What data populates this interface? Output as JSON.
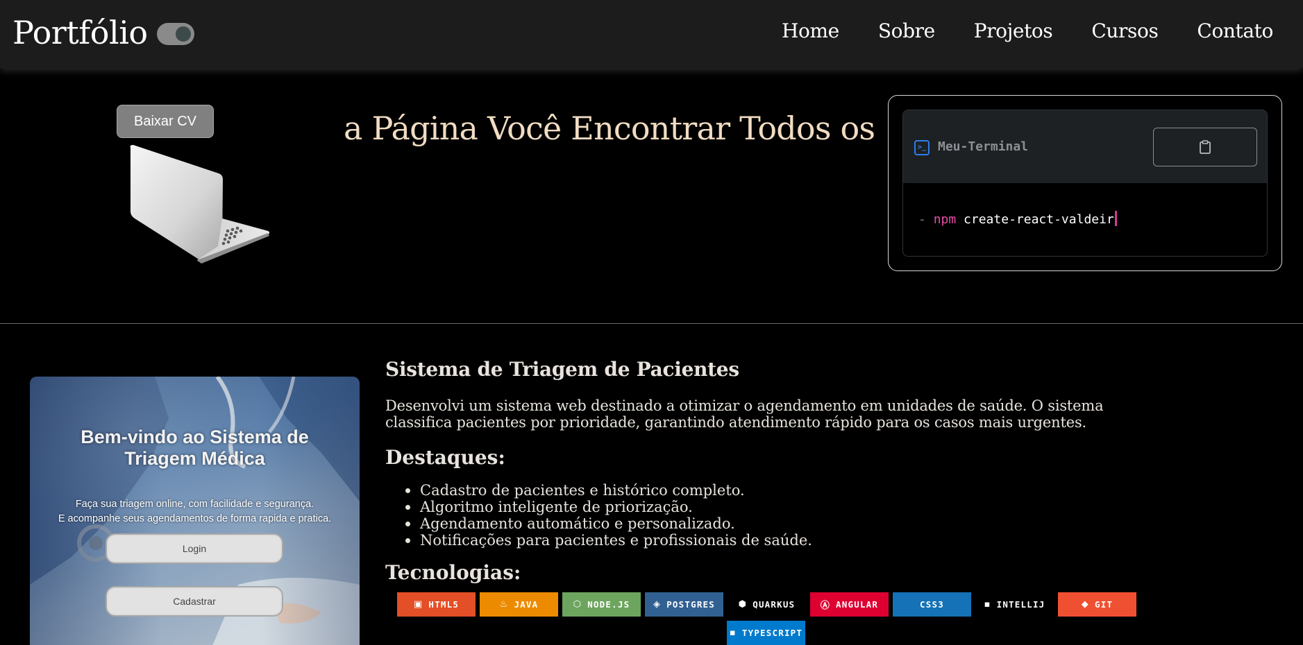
{
  "header": {
    "logo": "Portfólio",
    "nav": [
      "Home",
      "Sobre",
      "Projetos",
      "Cursos",
      "Contato"
    ]
  },
  "hero": {
    "cv_button": "Baixar CV",
    "typed_text": "a Página Você Encontrar Todos os"
  },
  "terminal": {
    "title": "Meu-Terminal",
    "prompt_dash": "-",
    "npm": "npm",
    "command": "create-react-valdeir"
  },
  "project": {
    "image": {
      "title_line1": "Bem-vindo ao Sistema de",
      "title_line2": "Triagem Médica",
      "sub_line1": "Faça sua triagem online, com facilidade e segurança.",
      "sub_line2": "E acompanhe seus agendamentos de forma rapida e pratica.",
      "login": "Login",
      "register": "Cadastrar"
    },
    "title": "Sistema de Triagem de Pacientes",
    "description_line1": "Desenvolvi um sistema web destinado a otimizar o agendamento em unidades de saúde. O sistema",
    "description_line2": "classifica pacientes por prioridade, garantindo atendimento rápido para os casos mais urgentes.",
    "highlights_heading": "Destaques:",
    "highlights": [
      "Cadastro de pacientes e histórico completo.",
      "Algoritmo inteligente de priorização.",
      "Agendamento automático e personalizado.",
      "Notificações para pacientes e profissionais de saúde."
    ],
    "tech_heading": "Tecnologias:",
    "technologies": [
      {
        "label": "HTML5",
        "color": "#e34f26",
        "icon": "html5-icon"
      },
      {
        "label": "JAVA",
        "color": "#ed8b00",
        "icon": "java-icon"
      },
      {
        "label": "NODE.JS",
        "color": "#6da55f",
        "icon": "nodejs-icon"
      },
      {
        "label": "POSTGRES",
        "color": "#316192",
        "icon": "postgres-icon"
      },
      {
        "label": "QUARKUS",
        "color": "#000000",
        "icon": "quarkus-icon"
      },
      {
        "label": "ANGULAR",
        "color": "#dd0031",
        "icon": "angular-icon"
      },
      {
        "label": "CSS3",
        "color": "#1572b6",
        "icon": "css3-icon"
      },
      {
        "label": "INTELLIJ",
        "color": "#000000",
        "icon": "intellij-icon"
      },
      {
        "label": "GIT",
        "color": "#f05032",
        "icon": "git-icon"
      },
      {
        "label": "TYPESCRIPT",
        "color": "#007acc",
        "icon": "typescript-icon"
      }
    ]
  }
}
